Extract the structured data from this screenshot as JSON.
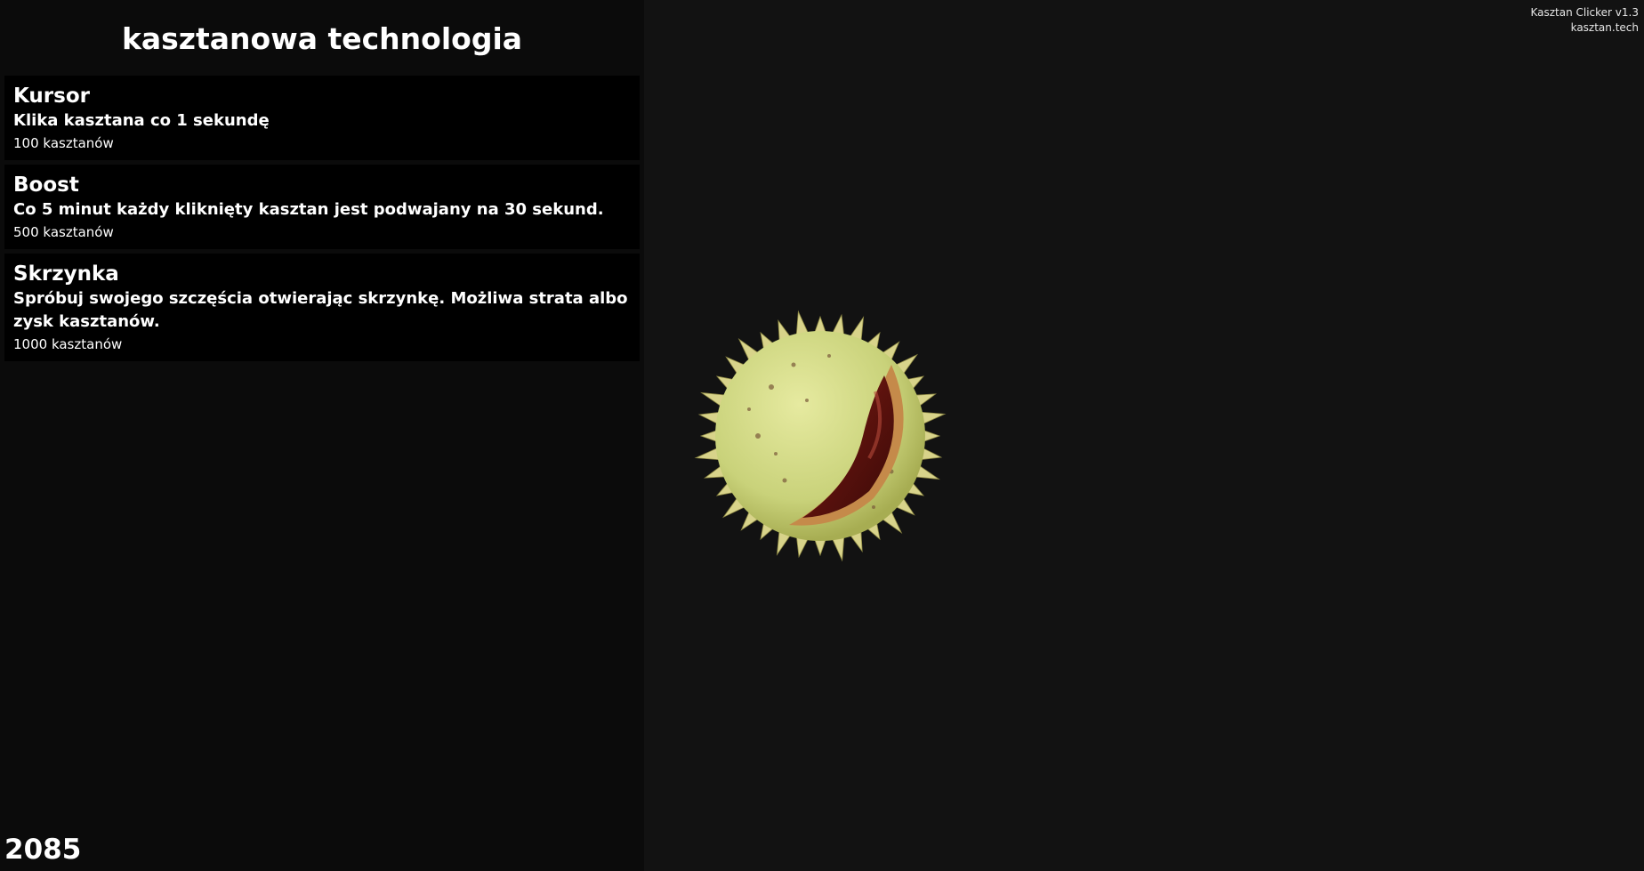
{
  "sidebar": {
    "title": "kasztanowa technologia",
    "items": [
      {
        "name": "Kursor",
        "description": "Klika kasztana co 1 sekundę",
        "price": "100 kasztanów"
      },
      {
        "name": "Boost",
        "description": "Co 5 minut każdy kliknięty kasztan jest podwajany na 30 sekund.",
        "price": "500 kasztanów"
      },
      {
        "name": "Skrzynka",
        "description": "Spróbuj swojego szczęścia otwierając skrzynkę. Możliwa strata albo zysk kasztanów.",
        "price": "1000 kasztanów"
      }
    ]
  },
  "counter": "2085",
  "version": {
    "line1": "Kasztan Clicker v1.3",
    "line2": "kasztan.tech"
  },
  "colors": {
    "background": "#121212",
    "sidebar": "#0b0b0b",
    "item": "#000000",
    "husk": "#c9d27a",
    "nut": "#6a1410"
  }
}
